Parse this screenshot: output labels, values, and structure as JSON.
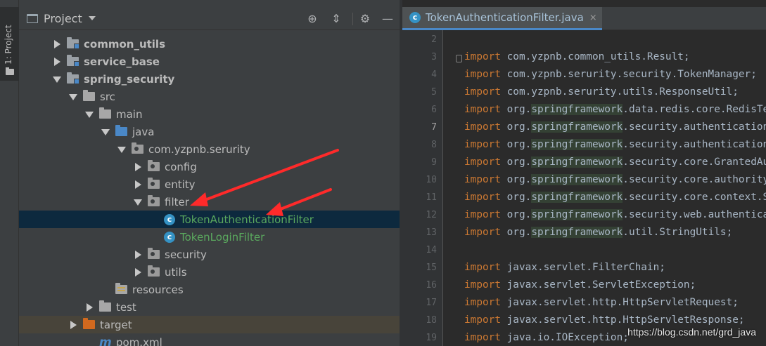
{
  "tool_stripe": {
    "project_tab_label": "1: Project"
  },
  "project_panel": {
    "title": "Project",
    "tree": [
      {
        "label": "common_utils",
        "kind": "module",
        "arrow": "right",
        "indent": 1,
        "bold": true
      },
      {
        "label": "service_base",
        "kind": "module",
        "arrow": "right",
        "indent": 1,
        "bold": true
      },
      {
        "label": "spring_security",
        "kind": "module",
        "arrow": "down",
        "indent": 1,
        "bold": true
      },
      {
        "label": "src",
        "kind": "src",
        "arrow": "down",
        "indent": 2
      },
      {
        "label": "main",
        "kind": "src",
        "arrow": "down",
        "indent": 3
      },
      {
        "label": "java",
        "kind": "blue",
        "arrow": "down",
        "indent": 4
      },
      {
        "label": "com.yzpnb.serurity",
        "kind": "pkg",
        "arrow": "down",
        "indent": 5
      },
      {
        "label": "config",
        "kind": "pkg",
        "arrow": "right",
        "indent": 6
      },
      {
        "label": "entity",
        "kind": "pkg",
        "arrow": "right",
        "indent": 6
      },
      {
        "label": "filter",
        "kind": "pkg",
        "arrow": "down",
        "indent": 6
      },
      {
        "label": "TokenAuthenticationFilter",
        "kind": "class",
        "arrow": "none",
        "indent": 7,
        "selected": true
      },
      {
        "label": "TokenLoginFilter",
        "kind": "class",
        "arrow": "none",
        "indent": 7
      },
      {
        "label": "security",
        "kind": "pkg",
        "arrow": "right",
        "indent": 6
      },
      {
        "label": "utils",
        "kind": "pkg",
        "arrow": "right",
        "indent": 6
      },
      {
        "label": "resources",
        "kind": "res",
        "arrow": "none",
        "indent": 4
      },
      {
        "label": "test",
        "kind": "src",
        "arrow": "right",
        "indent": 3
      },
      {
        "label": "target",
        "kind": "orange",
        "arrow": "right",
        "indent": 2,
        "excluded": true
      },
      {
        "label": "pom.xml",
        "kind": "maven",
        "arrow": "none",
        "indent": 3
      }
    ]
  },
  "editor": {
    "tab": {
      "label": "TokenAuthenticationFilter.java",
      "close_glyph": "×",
      "icon_letter": "c"
    },
    "lines": [
      {
        "num": "2",
        "kw": "",
        "text": ""
      },
      {
        "num": "3",
        "kw": "import",
        "text": " com.yzpnb.common_utils.Result;",
        "fold": true
      },
      {
        "num": "4",
        "kw": "import",
        "text": " com.yzpnb.serurity.security.TokenManager;"
      },
      {
        "num": "5",
        "kw": "import",
        "text": " com.yzpnb.serurity.utils.ResponseUtil;"
      },
      {
        "num": "6",
        "kw": "import",
        "text": " org.springframework.data.redis.core.RedisTemplate;"
      },
      {
        "num": "7",
        "kw": "import",
        "text": " org.springframework.security.authentication.AuthenticationManager;",
        "current": true
      },
      {
        "num": "8",
        "kw": "import",
        "text": " org.springframework.security.authentication.UsernamePasswordAuthenticationToken;"
      },
      {
        "num": "9",
        "kw": "import",
        "text": " org.springframework.security.core.GrantedAuthority;"
      },
      {
        "num": "10",
        "kw": "import",
        "text": " org.springframework.security.core.authority.SimpleGrantedAuthority;"
      },
      {
        "num": "11",
        "kw": "import",
        "text": " org.springframework.security.core.context.SecurityContextHolder;"
      },
      {
        "num": "12",
        "kw": "import",
        "text": " org.springframework.security.web.authentication.www.BasicAuthenticationFilter;"
      },
      {
        "num": "13",
        "kw": "import",
        "text": " org.springframework.util.StringUtils;"
      },
      {
        "num": "14",
        "kw": "",
        "text": ""
      },
      {
        "num": "15",
        "kw": "import",
        "text": " javax.servlet.FilterChain;"
      },
      {
        "num": "16",
        "kw": "import",
        "text": " javax.servlet.ServletException;"
      },
      {
        "num": "17",
        "kw": "import",
        "text": " javax.servlet.http.HttpServletRequest;"
      },
      {
        "num": "18",
        "kw": "import",
        "text": " javax.servlet.http.HttpServletResponse;"
      },
      {
        "num": "19",
        "kw": "import",
        "text": " java.io.IOException;"
      }
    ]
  },
  "watermark": "https://blog.csdn.net/grd_java",
  "colors": {
    "accent": "#4a88c7",
    "selection": "#0d293e",
    "keyword": "#cc7832",
    "annotation_arrow": "#ff2a2a"
  }
}
